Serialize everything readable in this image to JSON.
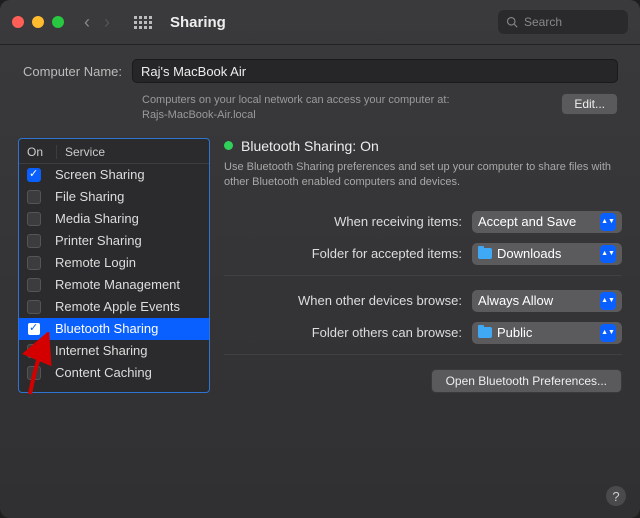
{
  "window": {
    "title": "Sharing"
  },
  "search": {
    "placeholder": "Search"
  },
  "computerName": {
    "label": "Computer Name:",
    "value": "Raj's MacBook Air",
    "subtext1": "Computers on your local network can access your computer at:",
    "subtext2": "Rajs-MacBook-Air.local",
    "editLabel": "Edit..."
  },
  "headers": {
    "on": "On",
    "service": "Service"
  },
  "services": [
    {
      "label": "Screen Sharing",
      "checked": true,
      "selected": false
    },
    {
      "label": "File Sharing",
      "checked": false,
      "selected": false
    },
    {
      "label": "Media Sharing",
      "checked": false,
      "selected": false
    },
    {
      "label": "Printer Sharing",
      "checked": false,
      "selected": false
    },
    {
      "label": "Remote Login",
      "checked": false,
      "selected": false
    },
    {
      "label": "Remote Management",
      "checked": false,
      "selected": false
    },
    {
      "label": "Remote Apple Events",
      "checked": false,
      "selected": false
    },
    {
      "label": "Bluetooth Sharing",
      "checked": true,
      "selected": true
    },
    {
      "label": "Internet Sharing",
      "checked": false,
      "selected": false
    },
    {
      "label": "Content Caching",
      "checked": false,
      "selected": false
    }
  ],
  "detail": {
    "statusTitle": "Bluetooth Sharing: On",
    "description": "Use Bluetooth Sharing preferences and set up your computer to share files with other Bluetooth enabled computers and devices.",
    "rows": {
      "whenReceiving": {
        "label": "When receiving items:",
        "value": "Accept and Save"
      },
      "acceptedFolder": {
        "label": "Folder for accepted items:",
        "value": "Downloads",
        "hasFolderIcon": true
      },
      "whenBrowse": {
        "label": "When other devices browse:",
        "value": "Always Allow"
      },
      "browseFolder": {
        "label": "Folder others can browse:",
        "value": "Public",
        "hasFolderIcon": true
      }
    },
    "openButton": "Open Bluetooth Preferences..."
  },
  "help": "?"
}
